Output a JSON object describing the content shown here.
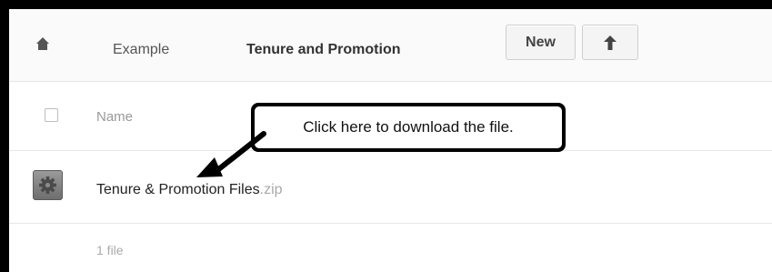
{
  "toolbar": {
    "home_icon": "home-icon",
    "breadcrumbs": [
      "Example",
      "Tenure and Promotion"
    ],
    "new_label": "New",
    "upload_icon": "arrow-up-icon"
  },
  "table": {
    "column_header": "Name",
    "rows": [
      {
        "name": "Tenure & Promotion Files",
        "ext": ".zip",
        "action_icon": "gear-icon"
      }
    ],
    "footer": "1 file"
  },
  "callout": {
    "text": "Click here to download the file."
  },
  "colors": {
    "border": "#000000",
    "toolbar_bg": "#fafafa",
    "gear_button": "#7d7d7d",
    "muted_text": "#999999"
  }
}
